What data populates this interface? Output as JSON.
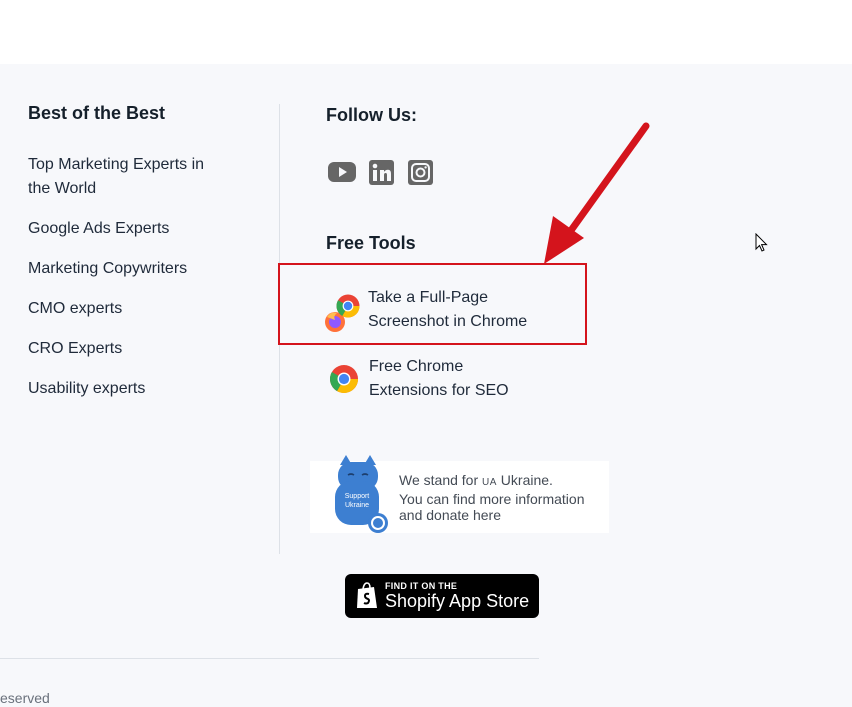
{
  "col_best": {
    "title": "Best of the Best",
    "links": [
      "Top Marketing Experts in",
      "the World",
      "Google Ads Experts",
      "Marketing Copywriters",
      "CMO experts",
      "CRO Experts",
      "Usability experts"
    ]
  },
  "col_follow": {
    "title": "Follow Us:",
    "icons": [
      "youtube-icon",
      "linkedin-icon",
      "instagram-icon"
    ]
  },
  "col_tools": {
    "title": "Free Tools",
    "tool1": {
      "line1": "Take a Full-Page",
      "line2": "Screenshot in Chrome"
    },
    "tool2": {
      "line1": "Free Chrome",
      "line2": "Extensions for SEO"
    }
  },
  "ukraine": {
    "line1_prefix": "We stand for ",
    "flag_text": "UA",
    "line1_suffix": " Ukraine.",
    "line2": "You can find more information",
    "line3": "and donate here",
    "cat_text_1": "Support",
    "cat_text_2": "Ukraine"
  },
  "shopify": {
    "small": "FIND IT ON THE",
    "big": "Shopify App Store"
  },
  "footer_bottom": {
    "rights": "eserved"
  },
  "colors": {
    "footer_bg": "#f7f8fb",
    "highlight": "#d4141c",
    "annotation_arrow": "#d4141c",
    "icon_gray": "#666666"
  }
}
